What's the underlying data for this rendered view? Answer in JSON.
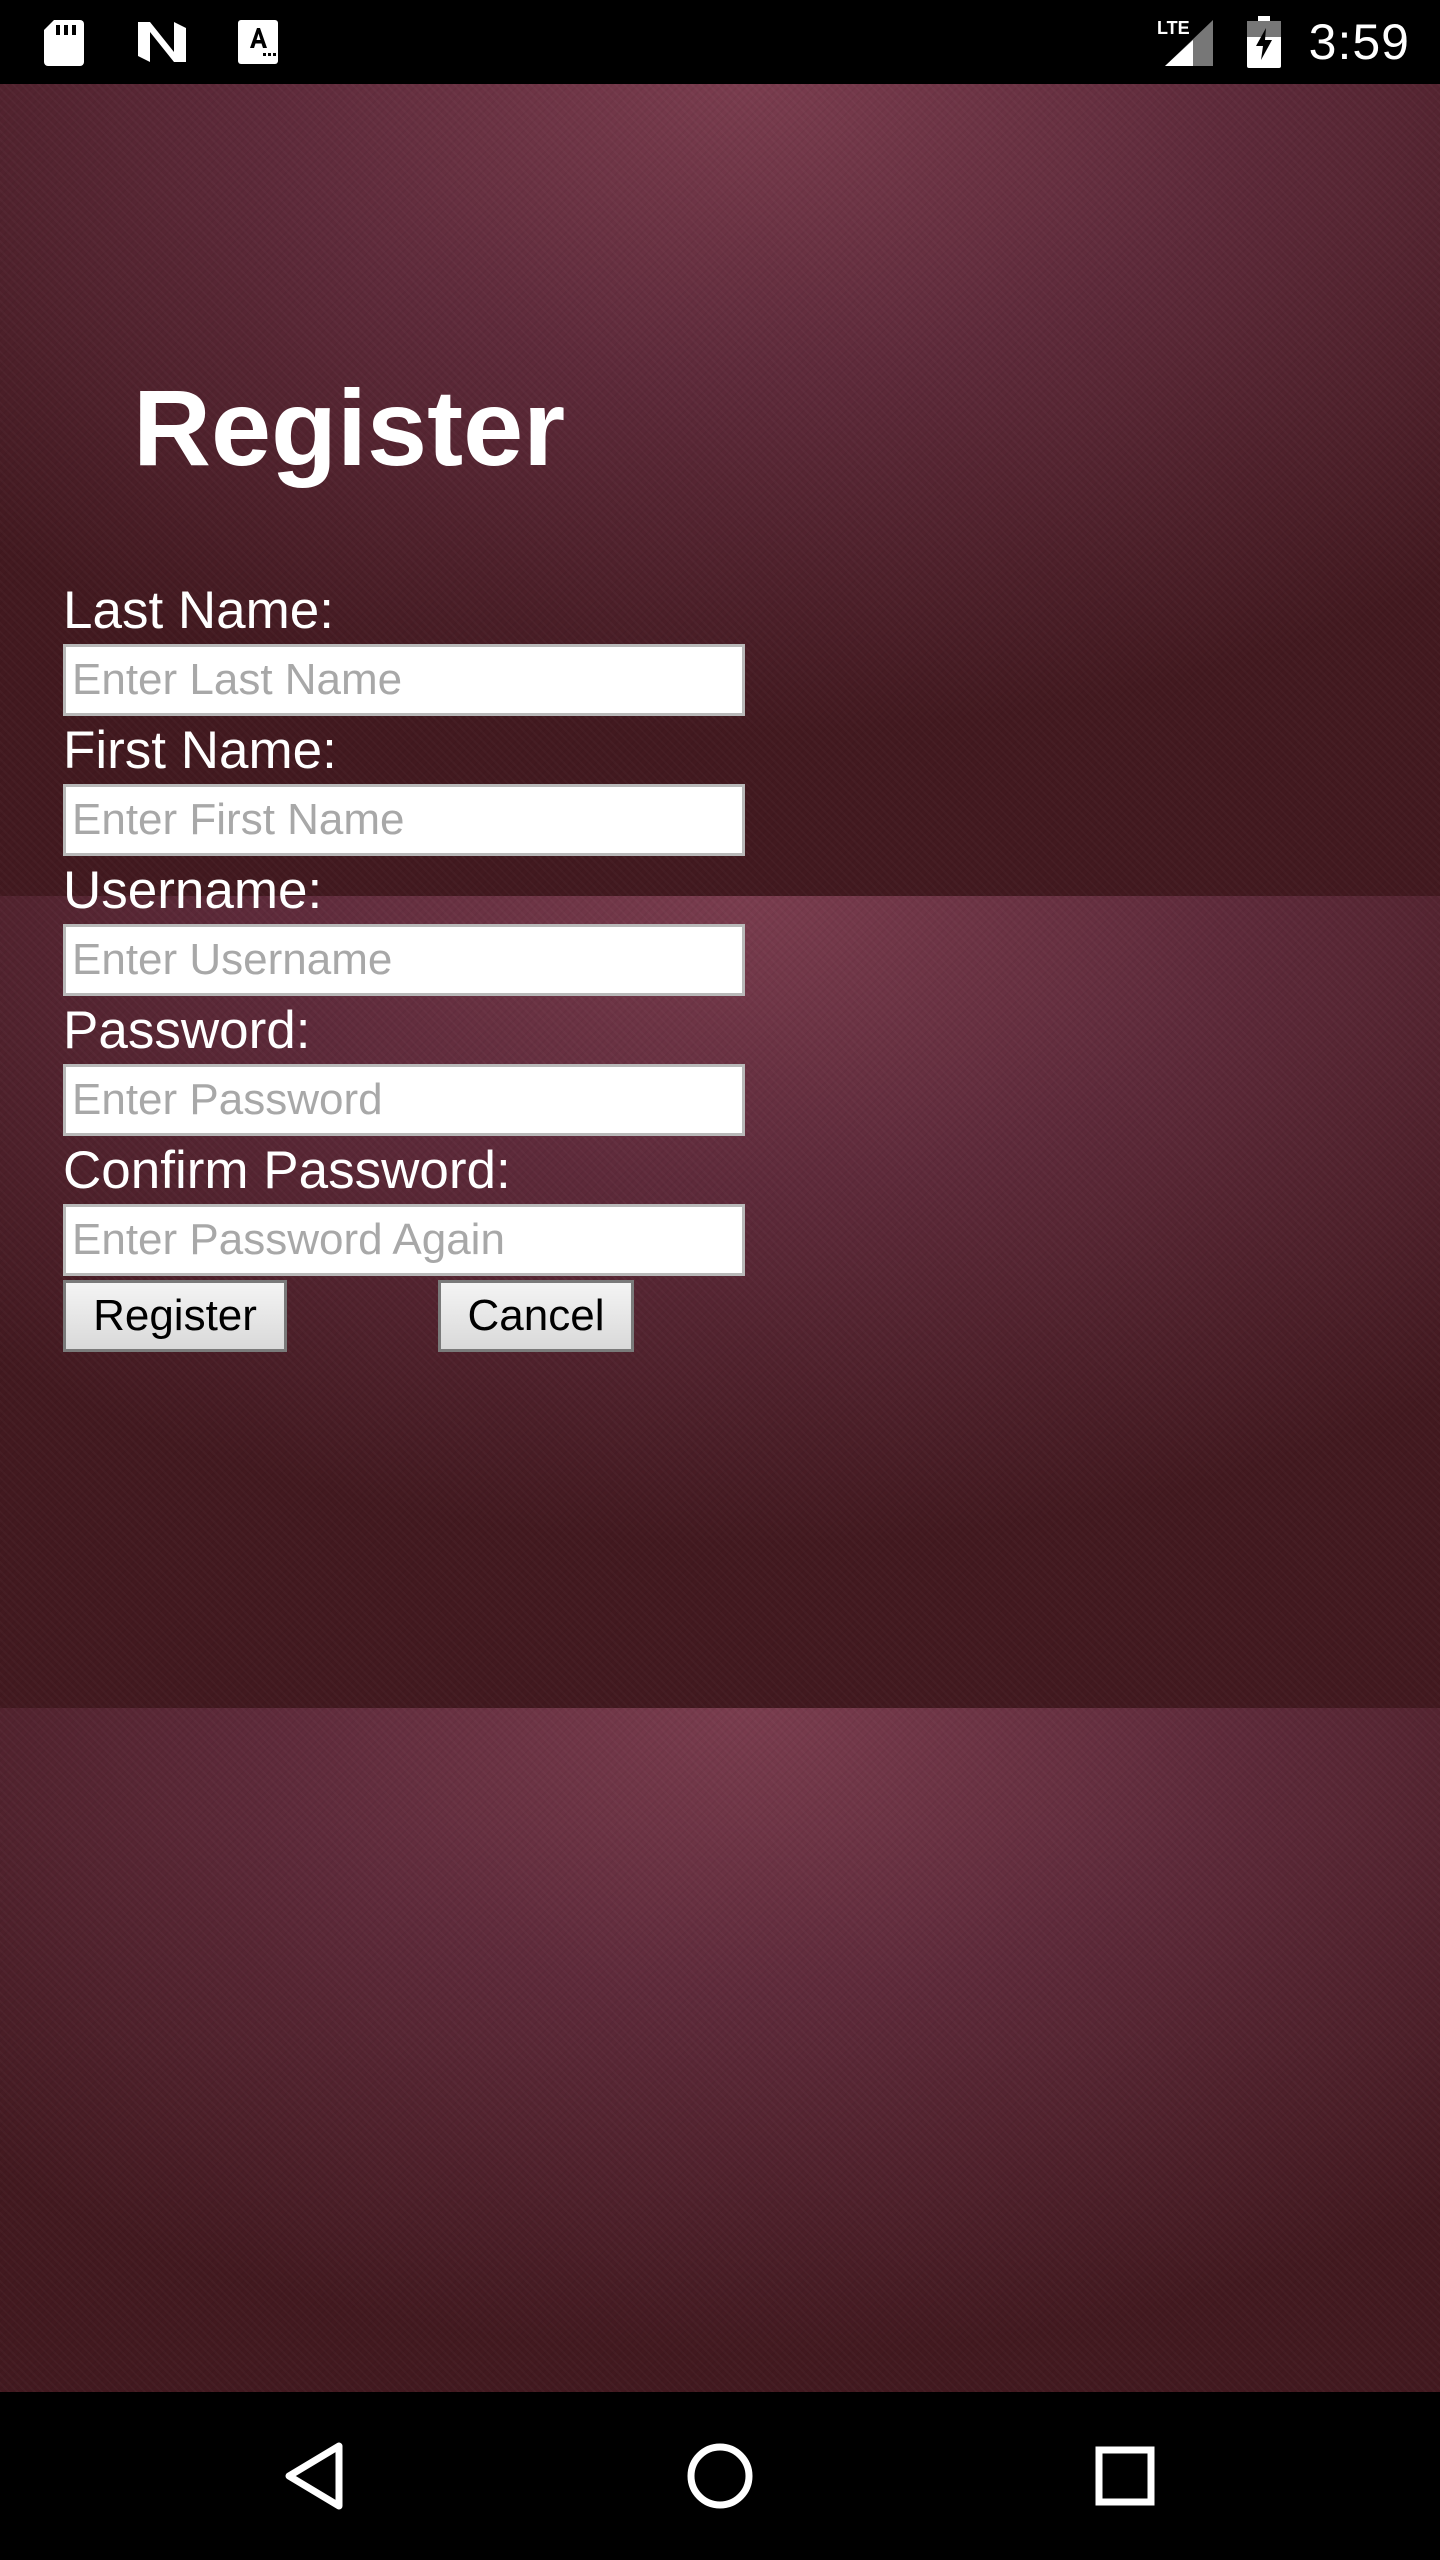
{
  "status_bar": {
    "time": "3:59",
    "left_icons": [
      "sd-card-icon",
      "n-logo-icon",
      "text-a-icon"
    ],
    "right_icons": [
      "lte-signal-icon",
      "battery-charging-icon"
    ],
    "network_label": "LTE"
  },
  "form": {
    "title": "Register",
    "fields": [
      {
        "label": "Last Name:",
        "placeholder": "Enter Last Name",
        "value": ""
      },
      {
        "label": "First Name:",
        "placeholder": "Enter First Name",
        "value": ""
      },
      {
        "label": "Username:",
        "placeholder": "Enter Username",
        "value": ""
      },
      {
        "label": "Password:",
        "placeholder": "Enter Password",
        "value": ""
      },
      {
        "label": "Confirm Password:",
        "placeholder": "Enter Password Again",
        "value": ""
      }
    ],
    "register_label": "Register",
    "cancel_label": "Cancel"
  },
  "nav_bar": {
    "icons": [
      "back-icon",
      "home-icon",
      "recents-icon"
    ]
  },
  "colors": {
    "background": "#5e2a3a",
    "text": "#ffffff",
    "field_background": "#ffffff",
    "placeholder": "#a8a8a8"
  }
}
